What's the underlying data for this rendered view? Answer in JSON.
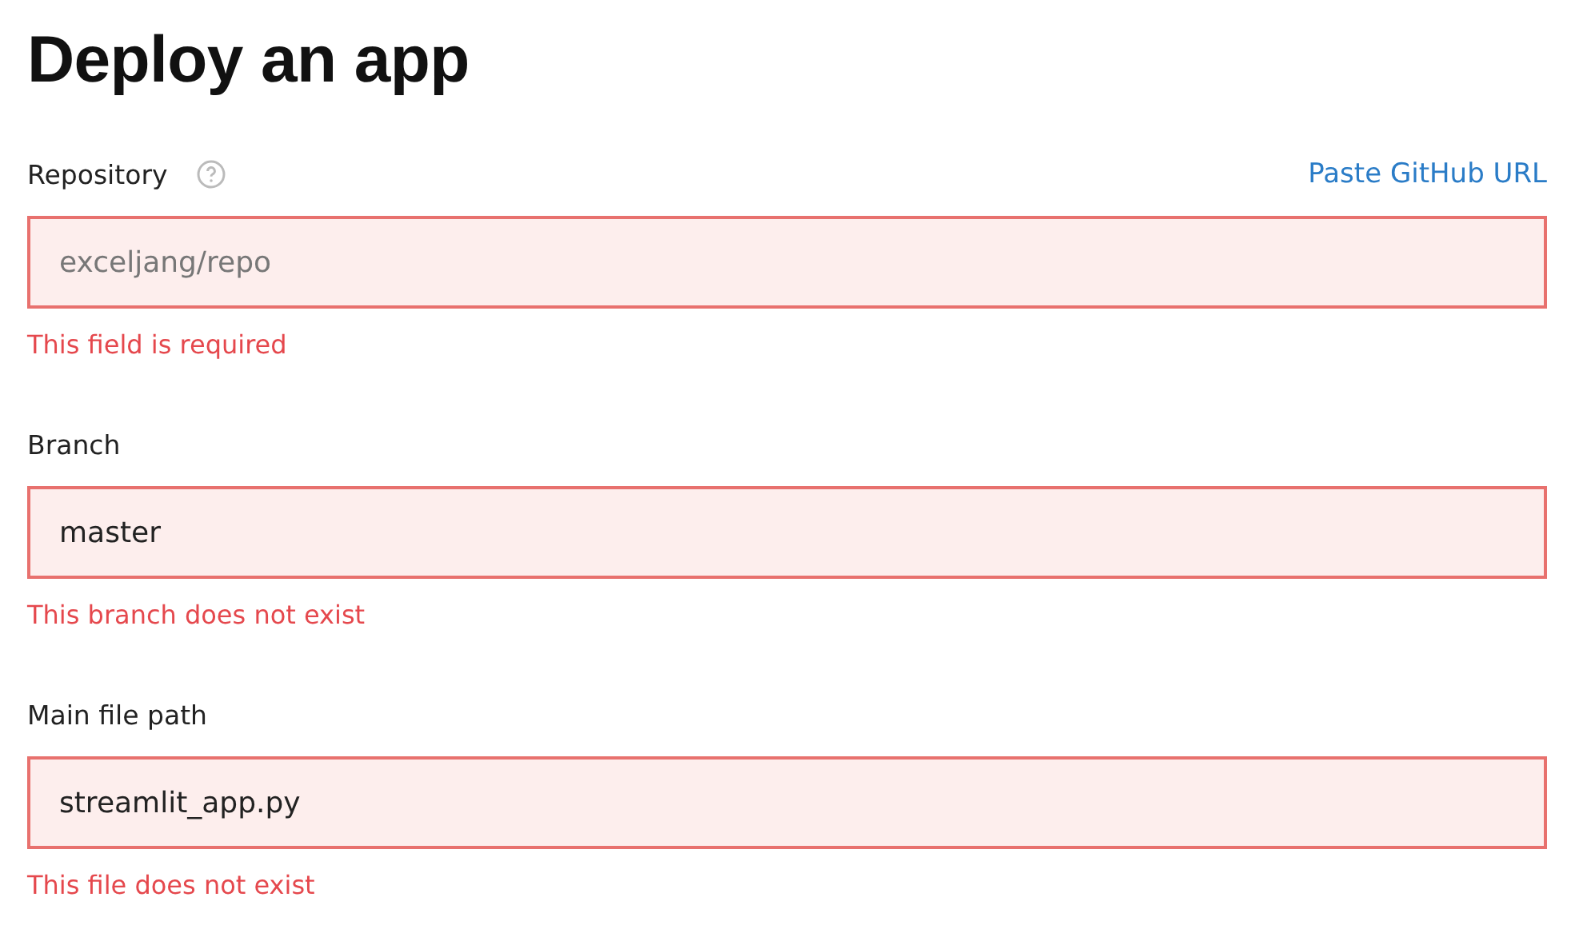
{
  "title": "Deploy an app",
  "fields": [
    {
      "label": "Repository",
      "help": true,
      "link": "Paste GitHub URL",
      "placeholder": "exceljang/repo",
      "invalid": true,
      "error": "This field is required"
    },
    {
      "label": "Branch",
      "help": false,
      "value": "master",
      "invalid": true,
      "error": "This branch does not exist"
    },
    {
      "label": "Main file path",
      "help": false,
      "value": "streamlit_app.py",
      "invalid": true,
      "error": "This file does not exist"
    }
  ]
}
